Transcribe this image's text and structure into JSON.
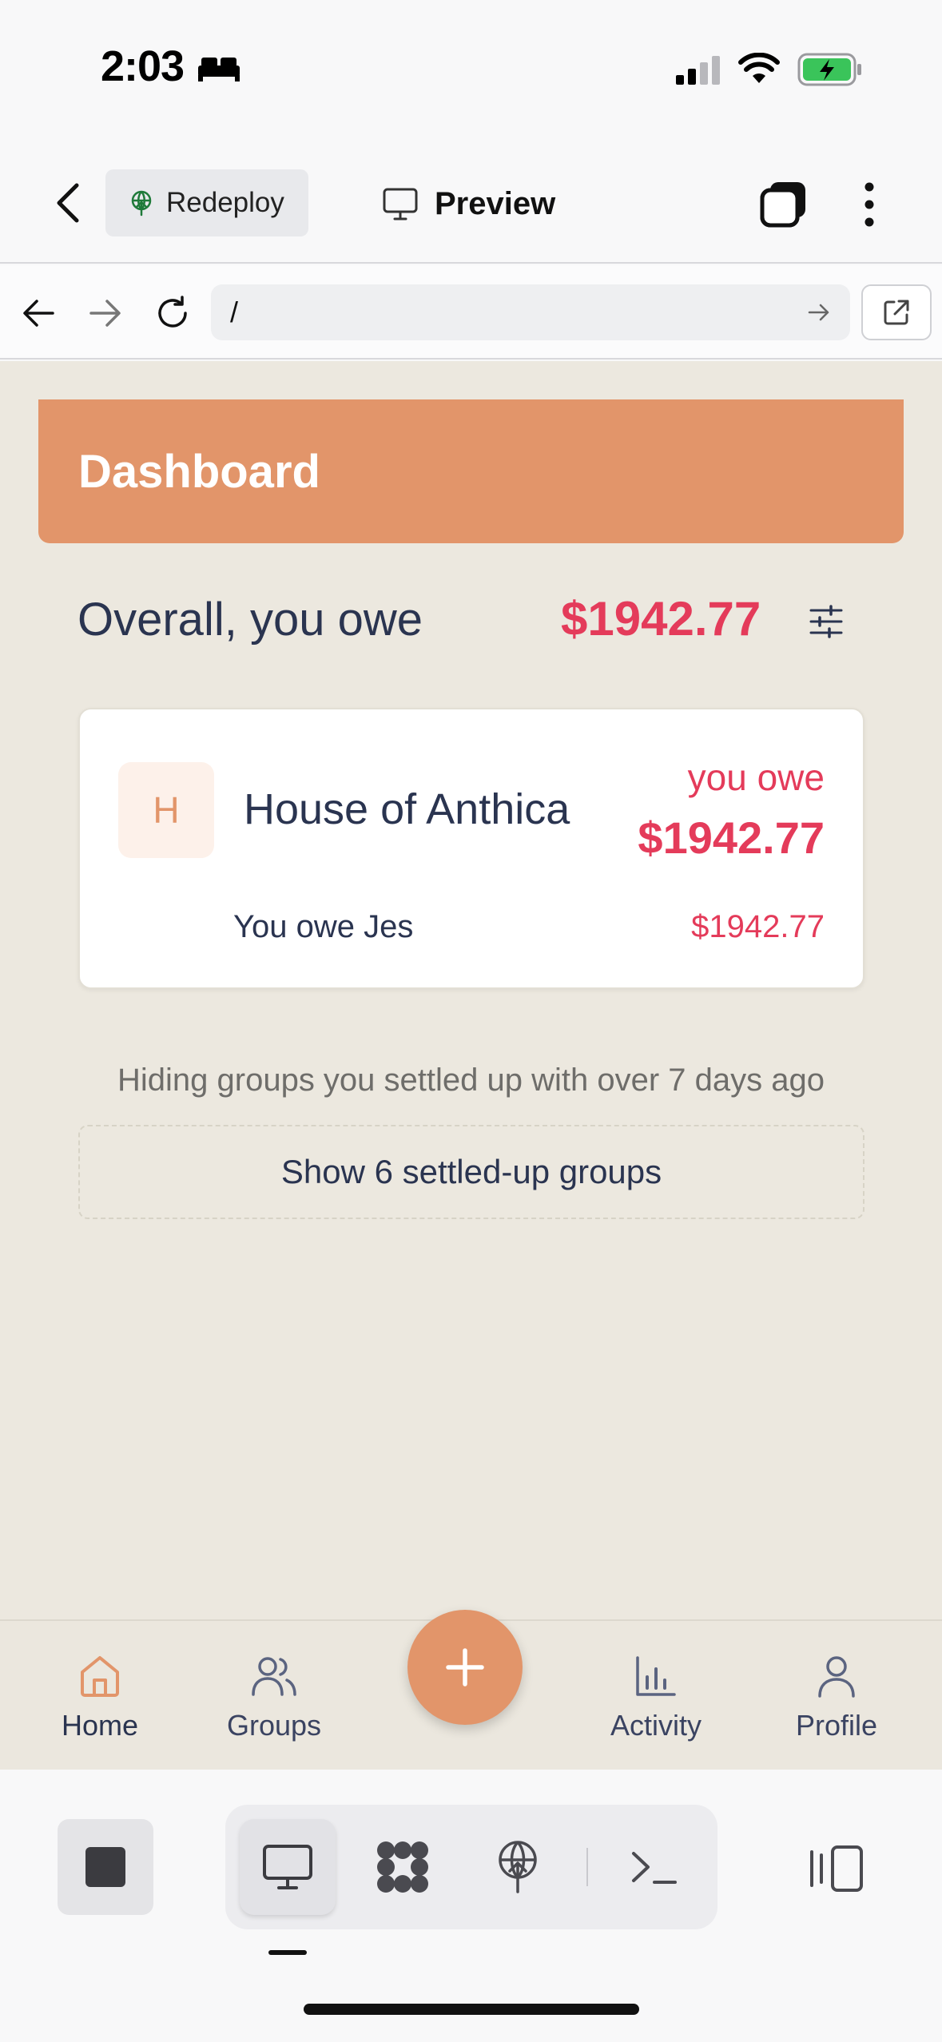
{
  "status_bar": {
    "time": "2:03"
  },
  "app_toolbar": {
    "redeploy_label": "Redeploy",
    "preview_label": "Preview"
  },
  "browser": {
    "url": "/"
  },
  "dashboard": {
    "header_title": "Dashboard",
    "overall_label": "Overall, you owe",
    "overall_amount": "$1942.77",
    "groups": [
      {
        "initial": "H",
        "name": "House of Anthica",
        "status_label": "you owe",
        "amount": "$1942.77",
        "details": [
          {
            "text": "You owe Jes",
            "amount": "$1942.77"
          }
        ]
      }
    ],
    "hiding_note": "Hiding groups you settled up with over 7 days ago",
    "show_settled_label": "Show 6 settled-up groups"
  },
  "bottom_nav": {
    "items": [
      {
        "label": "Home",
        "icon": "home-icon"
      },
      {
        "label": "Groups",
        "icon": "users-icon"
      },
      {
        "label": "Activity",
        "icon": "bar-chart-icon"
      },
      {
        "label": "Profile",
        "icon": "user-icon"
      }
    ],
    "fab_icon": "plus-icon"
  },
  "colors": {
    "accent": "#e2956a",
    "owe_red": "#e43b5a",
    "text_navy": "#2a3450",
    "page_bg": "#ece8df"
  }
}
